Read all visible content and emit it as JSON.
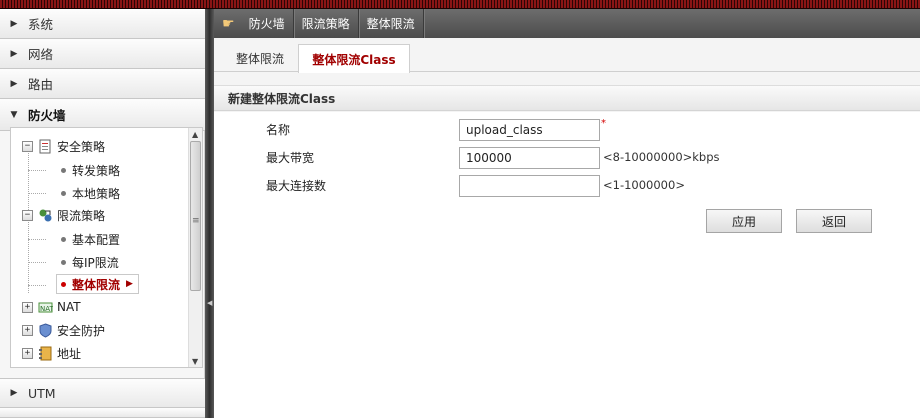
{
  "breadcrumb": [
    "防火墙",
    "限流策略",
    "整体限流"
  ],
  "sidebar": {
    "top_items": [
      "系统",
      "网络",
      "路由"
    ],
    "open_item": "防火墙",
    "bottom_items": [
      "UTM"
    ]
  },
  "tree": {
    "security_policy": "安全策略",
    "forward_policy": "转发策略",
    "local_policy": "本地策略",
    "rate_limit_policy": "限流策略",
    "basic_config": "基本配置",
    "per_ip_limit": "每IP限流",
    "overall_limit": "整体限流",
    "nat": "NAT",
    "security_protection": "安全防护",
    "address": "地址"
  },
  "tabs": [
    "整体限流",
    "整体限流Class"
  ],
  "active_tab": 1,
  "section_title": "新建整体限流Class",
  "form": {
    "name_label": "名称",
    "name_value": "upload_class",
    "required_mark": "*",
    "bandwidth_label": "最大带宽",
    "bandwidth_value": "100000",
    "bandwidth_hint": "<8-10000000>kbps",
    "conn_label": "最大连接数",
    "conn_value": "",
    "conn_hint": "<1-1000000>"
  },
  "buttons": {
    "apply": "应用",
    "back": "返回"
  },
  "colors": {
    "accent_red": "#a10000",
    "header_dark": "#4c4c4c"
  }
}
